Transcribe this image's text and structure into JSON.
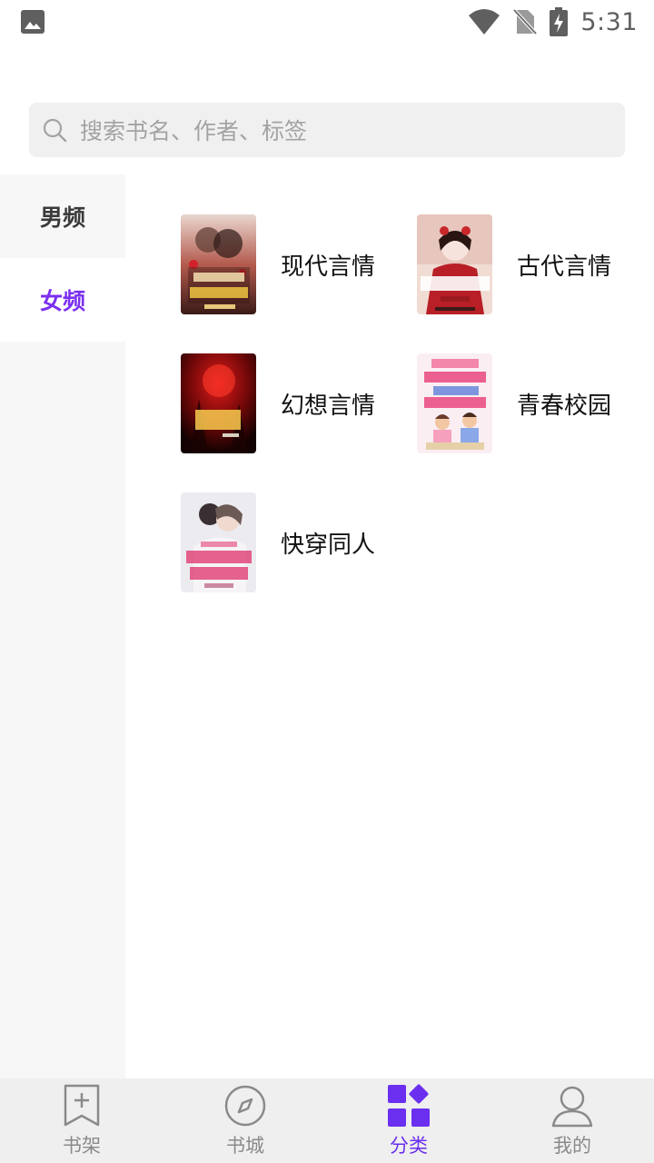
{
  "status_bar": {
    "time": "5:31",
    "icons": [
      "image-icon",
      "wifi-icon",
      "no-sim-icon",
      "battery-charging-icon"
    ]
  },
  "search": {
    "placeholder": "搜索书名、作者、标签"
  },
  "sidebar": {
    "items": [
      {
        "label": "男频",
        "selected": false
      },
      {
        "label": "女频",
        "selected": true
      }
    ]
  },
  "categories": [
    {
      "label": "现代言情",
      "cover_title": "小娇妻又作妖了"
    },
    {
      "label": "古代言情",
      "cover_title": "神医毒妃"
    },
    {
      "label": "幻想言情",
      "cover_title": "蛇棺"
    },
    {
      "label": "青春校园",
      "cover_title": "我的同桌发糖吗"
    },
    {
      "label": "快穿同人",
      "cover_title": "残疾大佬的小娇妻"
    }
  ],
  "bottom_nav": {
    "items": [
      {
        "label": "书架",
        "icon": "bookmark-plus-icon",
        "active": false
      },
      {
        "label": "书城",
        "icon": "compass-icon",
        "active": false
      },
      {
        "label": "分类",
        "icon": "category-grid-icon",
        "active": true
      },
      {
        "label": "我的",
        "icon": "person-icon",
        "active": false
      }
    ]
  },
  "colors": {
    "accent": "#7b2ff0",
    "sidebar_bg": "#f7f7f7",
    "search_bg": "#f0f0f0",
    "nav_bg": "#efefef"
  }
}
